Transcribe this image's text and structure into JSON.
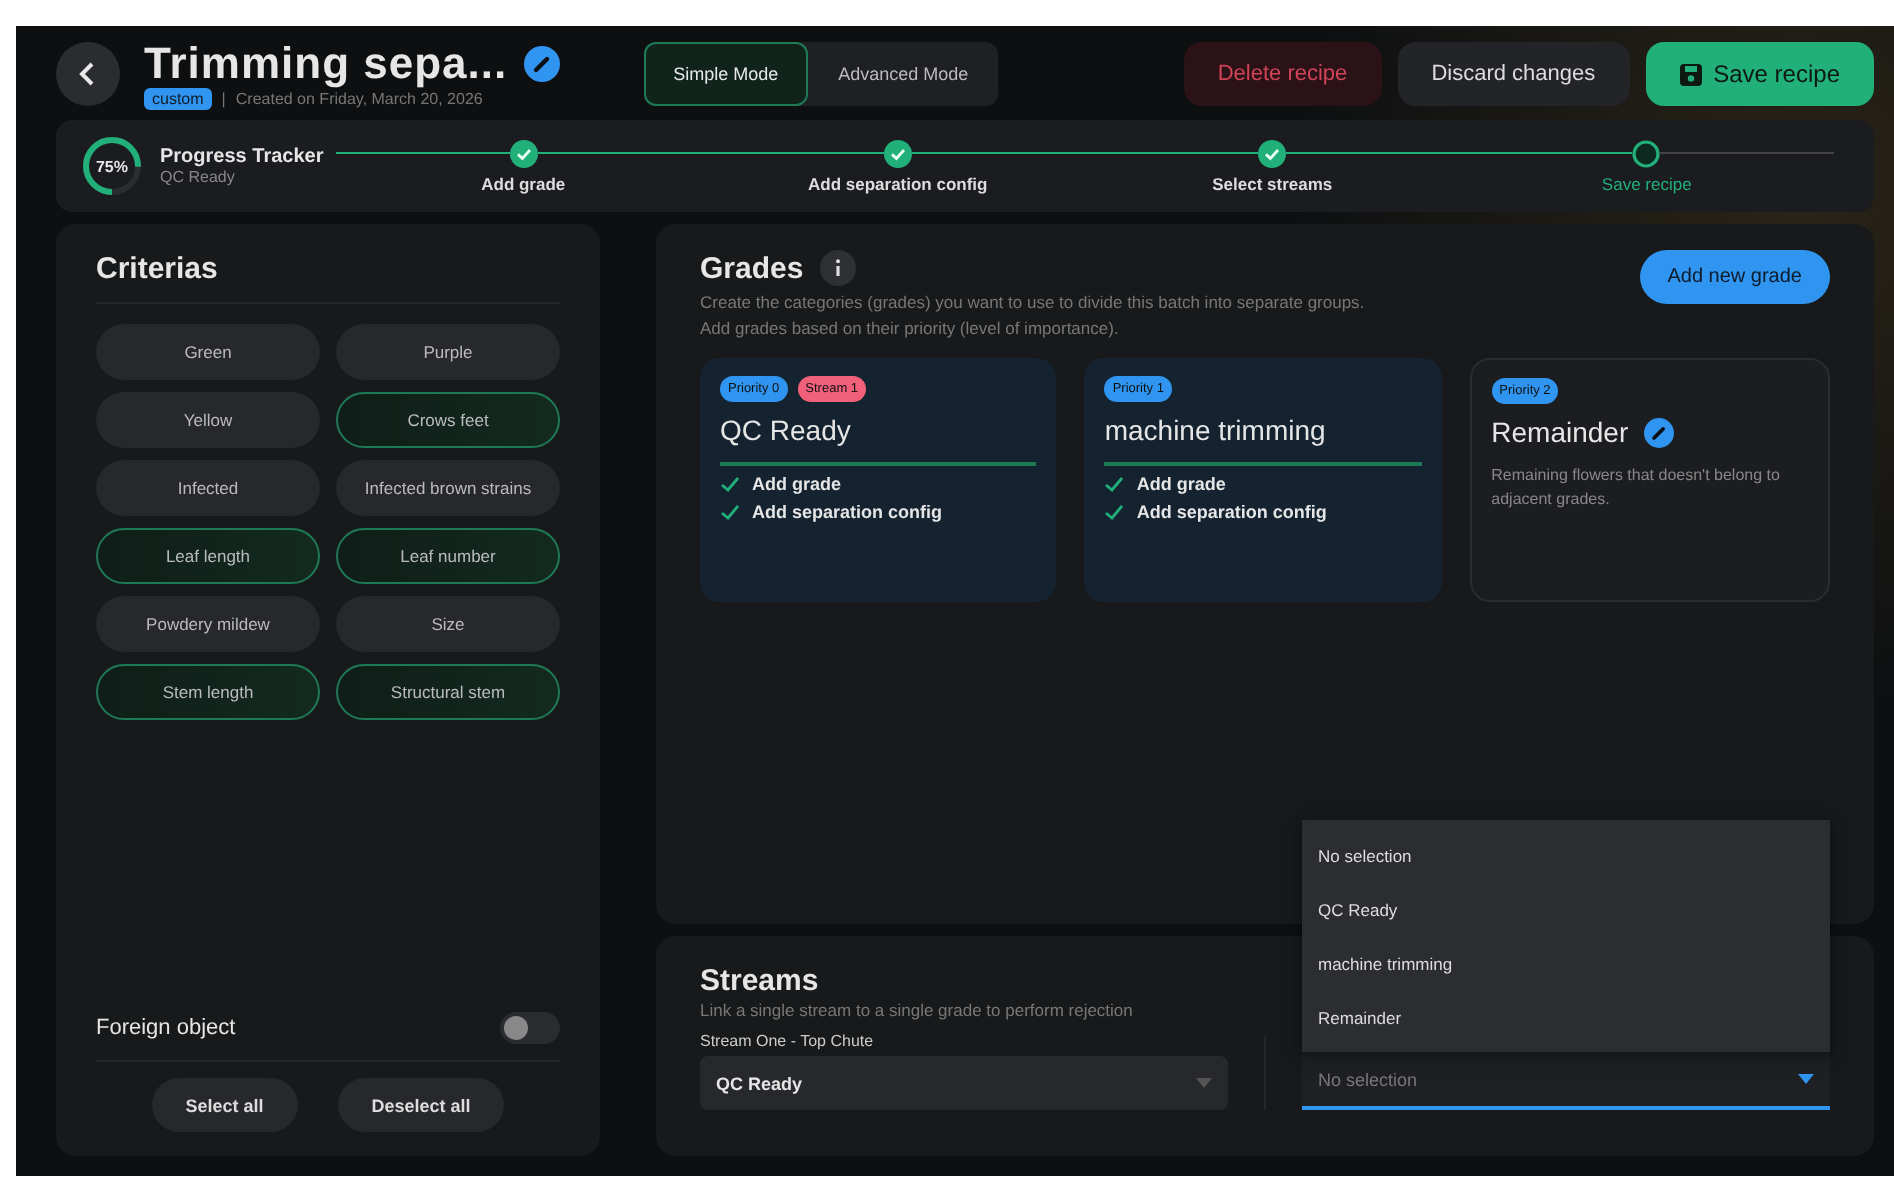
{
  "header": {
    "title": "Trimming sepa...",
    "tag": "custom",
    "created": "Created on Friday, March 20, 2026",
    "separator": "|",
    "modes": [
      {
        "label": "Simple Mode",
        "selected": true
      },
      {
        "label": "Advanced Mode",
        "selected": false
      }
    ],
    "actions": [
      {
        "kind": "danger",
        "label": "Delete recipe"
      },
      {
        "kind": "neutral",
        "label": "Discard changes"
      },
      {
        "kind": "primary",
        "label": "Save recipe"
      }
    ]
  },
  "progress": {
    "percent": "75%",
    "level": 0.75,
    "title": "Progress Tracker",
    "subtitle": "QC Ready",
    "steps": [
      {
        "label": "Add grade",
        "done": true,
        "current": false
      },
      {
        "label": "Add separation config",
        "done": true,
        "current": false
      },
      {
        "label": "Select streams",
        "done": true,
        "current": false
      },
      {
        "label": "Save recipe",
        "done": false,
        "current": true
      }
    ]
  },
  "criteria": {
    "title": "Criterias",
    "items": [
      {
        "label": "Green",
        "selected": false
      },
      {
        "label": "Purple",
        "selected": false
      },
      {
        "label": "Yellow",
        "selected": false
      },
      {
        "label": "Crows feet",
        "selected": true
      },
      {
        "label": "Infected",
        "selected": false
      },
      {
        "label": "Infected brown strains",
        "selected": false
      },
      {
        "label": "Leaf length",
        "selected": true
      },
      {
        "label": "Leaf number",
        "selected": true
      },
      {
        "label": "Powdery mildew",
        "selected": false
      },
      {
        "label": "Size",
        "selected": false
      },
      {
        "label": "Stem length",
        "selected": true
      },
      {
        "label": "Structural stem",
        "selected": true
      }
    ],
    "toggle": {
      "label": "Foreign object",
      "on": false
    },
    "buttons": [
      "Select all",
      "Deselect all"
    ]
  },
  "grades": {
    "title": "Grades",
    "description": "Create the categories (grades) you want to use to divide this batch into separate groups. Add grades based on their priority (level of importance).",
    "add_button": "Add new grade",
    "cards": [
      {
        "kind": "configured",
        "priority": "Priority 0",
        "stream": "Stream 1",
        "name": "QC Ready",
        "editable": false,
        "checks": [
          "Add grade",
          "Add separation config"
        ]
      },
      {
        "kind": "configured",
        "priority": "Priority 1",
        "name": "machine trimming",
        "editable": false,
        "checks": [
          "Add grade",
          "Add separation config"
        ]
      },
      {
        "kind": "remainder",
        "priority": "Priority 2",
        "name": "Remainder",
        "editable": true,
        "description": "Remaining flowers that doesn't belong to adjacent grades."
      }
    ]
  },
  "streams": {
    "title": "Streams",
    "description": "Link a single stream to a single grade to perform rejection",
    "selects": [
      {
        "label": "Stream One - Top Chute",
        "value": "QC Ready",
        "open": false
      },
      {
        "placeholder": "No selection",
        "open": true
      }
    ],
    "options": [
      {
        "label": "No selection",
        "selected": false
      },
      {
        "label": "QC Ready",
        "selected": false
      },
      {
        "label": "machine trimming",
        "selected": false
      },
      {
        "label": "Remainder",
        "selected": false
      }
    ]
  }
}
